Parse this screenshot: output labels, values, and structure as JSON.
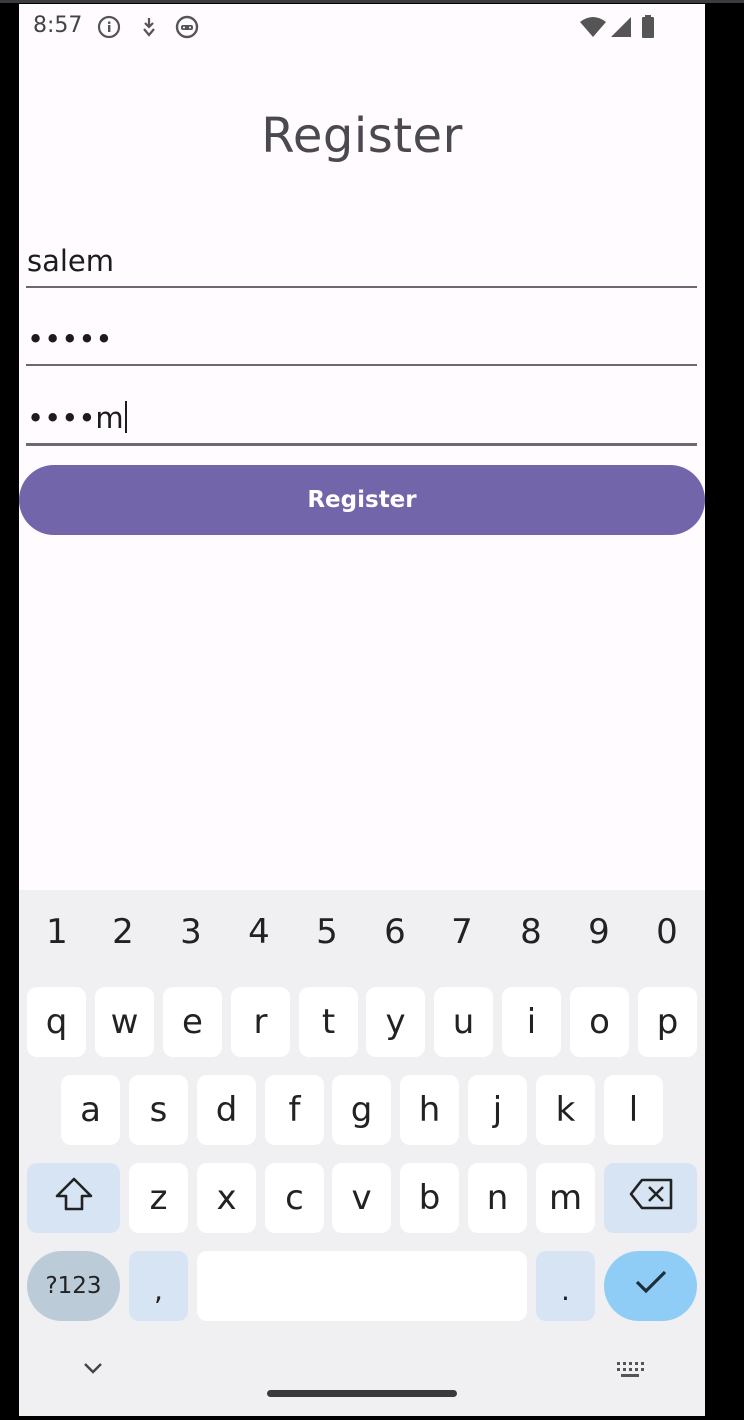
{
  "status_bar": {
    "time": "8:57"
  },
  "screen": {
    "title": "Register",
    "fields": {
      "username_value": "salem",
      "password_value": "•••••",
      "confirm_value": "••••m"
    },
    "register_button_label": "Register"
  },
  "keyboard": {
    "numbers": [
      "1",
      "2",
      "3",
      "4",
      "5",
      "6",
      "7",
      "8",
      "9",
      "0"
    ],
    "row1": [
      "q",
      "w",
      "e",
      "r",
      "t",
      "y",
      "u",
      "i",
      "o",
      "p"
    ],
    "row2": [
      "a",
      "s",
      "d",
      "f",
      "g",
      "h",
      "j",
      "k",
      "l"
    ],
    "row3": [
      "z",
      "x",
      "c",
      "v",
      "b",
      "n",
      "m"
    ],
    "symbols_label": "?123",
    "comma": ",",
    "period": "."
  }
}
